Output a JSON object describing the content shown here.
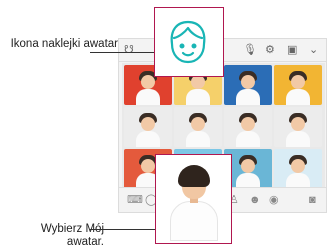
{
  "callouts": {
    "sticker_icon": "Ikona naklejki awatar",
    "my_avatar": "Wybierz Mój awatar."
  },
  "toolbar": {
    "icons": [
      "sticker-switch-icon",
      "mic-icon",
      "gear-icon",
      "clipboard-icon",
      "chevron-down-icon"
    ]
  },
  "bottom_bar": {
    "icons": [
      "keyboard-icon",
      "emoji-icon",
      "avatar-sticker-tab-icon",
      "animal-sticker-tab-icon",
      "camera-icon"
    ]
  },
  "colors": {
    "highlight": "#b0174f",
    "sticker_icon": "#19b5b5"
  },
  "sticker_grid": {
    "rows": 3,
    "columns": 4
  }
}
